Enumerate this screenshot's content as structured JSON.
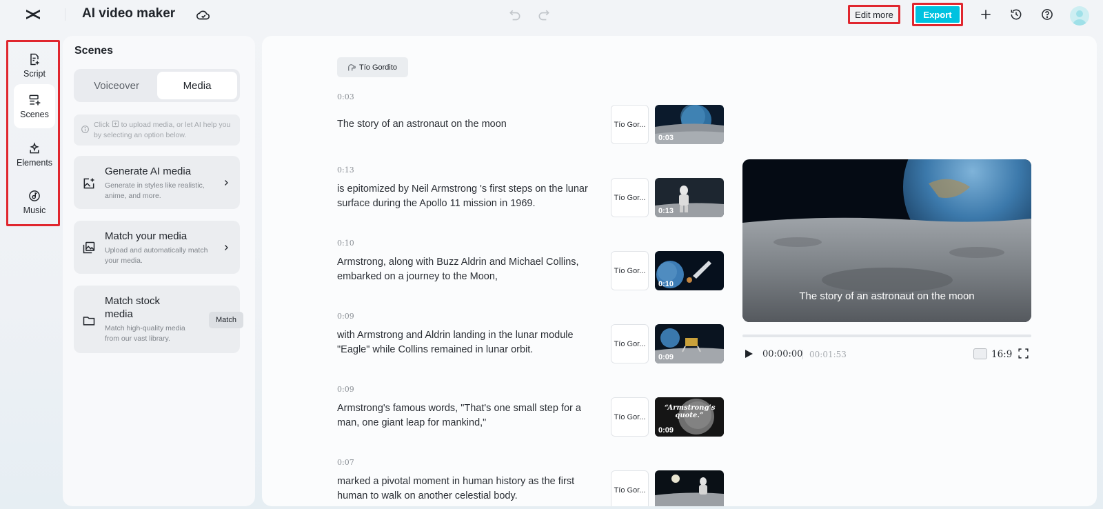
{
  "app": {
    "title": "AI video maker",
    "accent_color": "#00c2e0"
  },
  "toolbar": {
    "edit_more_label": "Edit more",
    "export_label": "Export",
    "icons": [
      "cloud-icon",
      "undo-icon",
      "redo-icon",
      "plus-icon",
      "history-icon",
      "help-icon"
    ]
  },
  "rail": {
    "items": [
      {
        "label": "Script",
        "icon": "script-icon",
        "active": false
      },
      {
        "label": "Scenes",
        "icon": "scenes-icon",
        "active": true
      },
      {
        "label": "Elements",
        "icon": "elements-icon",
        "active": false
      },
      {
        "label": "Music",
        "icon": "music-icon",
        "active": false
      }
    ]
  },
  "scenes_panel": {
    "title": "Scenes",
    "tabs": [
      {
        "label": "Voiceover",
        "active": false
      },
      {
        "label": "Media",
        "active": true
      }
    ],
    "hint_part1": "Click",
    "hint_part2": "to upload media, or let AI help you by selecting an option below.",
    "cards": [
      {
        "title": "Generate AI media",
        "desc": "Generate in styles like realistic, anime, and more.",
        "icon": "ai-image-icon"
      },
      {
        "title": "Match your media",
        "desc": "Upload and automatically match your media.",
        "icon": "gallery-icon"
      },
      {
        "title": "Match stock media",
        "desc": "Match high-quality media from our vast library.",
        "icon": "folder-icon",
        "button": "Match"
      }
    ]
  },
  "script": {
    "voice_name": "Tío Gordito",
    "voice_short": "Tío Gor...",
    "scenes": [
      {
        "duration": "0:03",
        "text": "The story of an astronaut on the moon"
      },
      {
        "duration": "0:13",
        "text": "is epitomized by Neil Armstrong 's first steps on the lunar surface during the Apollo 11 mission in 1969."
      },
      {
        "duration": "0:10",
        "text": "Armstrong, along with Buzz Aldrin and Michael Collins, embarked on a journey to the Moon,"
      },
      {
        "duration": "0:09",
        "text": "with Armstrong and Aldrin landing in the lunar module \"Eagle\" while Collins remained in lunar orbit."
      },
      {
        "duration": "0:09",
        "text": "Armstrong's famous words, \"That's one small step for a man, one giant leap for mankind,\"",
        "thumb_text": "“Armstrong’s quote.”"
      },
      {
        "duration": "0:07",
        "text": "marked a pivotal moment in human history as the first human to walk on another celestial body."
      }
    ]
  },
  "preview": {
    "subtitle": "The story of an astronaut on the moon",
    "current_time": "00:00:00",
    "total_time": "00:01:53",
    "aspect_ratio": "16:9",
    "progress": 0
  }
}
